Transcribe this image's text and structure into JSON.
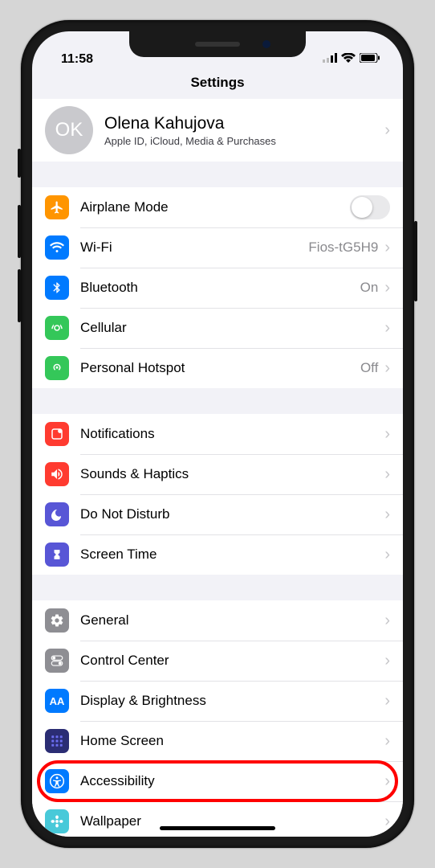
{
  "status": {
    "time": "11:58"
  },
  "title": "Settings",
  "profile": {
    "initials": "OK",
    "name": "Olena Kahujova",
    "subtitle": "Apple ID, iCloud, Media & Purchases"
  },
  "group1": {
    "airplane": {
      "label": "Airplane Mode"
    },
    "wifi": {
      "label": "Wi-Fi",
      "value": "Fios-tG5H9"
    },
    "bluetooth": {
      "label": "Bluetooth",
      "value": "On"
    },
    "cellular": {
      "label": "Cellular"
    },
    "hotspot": {
      "label": "Personal Hotspot",
      "value": "Off"
    }
  },
  "group2": {
    "notifications": {
      "label": "Notifications"
    },
    "sounds": {
      "label": "Sounds & Haptics"
    },
    "dnd": {
      "label": "Do Not Disturb"
    },
    "screentime": {
      "label": "Screen Time"
    }
  },
  "group3": {
    "general": {
      "label": "General"
    },
    "controlcenter": {
      "label": "Control Center"
    },
    "display": {
      "label": "Display & Brightness"
    },
    "homescreen": {
      "label": "Home Screen"
    },
    "accessibility": {
      "label": "Accessibility"
    },
    "wallpaper": {
      "label": "Wallpaper"
    }
  },
  "highlighted_item": "accessibility"
}
